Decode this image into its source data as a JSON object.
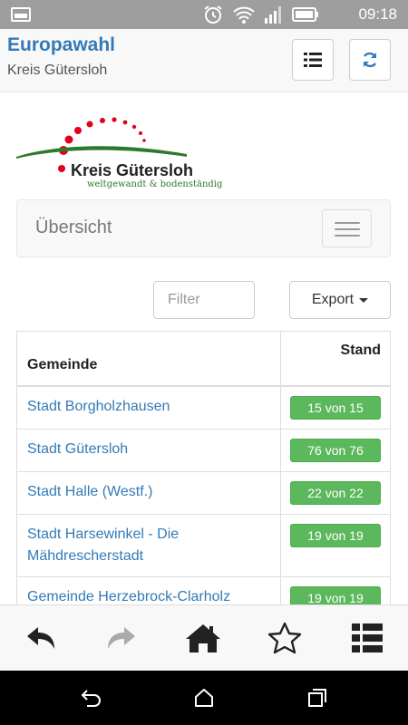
{
  "status_bar": {
    "time": "09:18",
    "icons": [
      "image-icon",
      "alarm-icon",
      "wifi-icon",
      "signal-icon",
      "battery-icon"
    ]
  },
  "header": {
    "title": "Europawahl",
    "subtitle": "Kreis Gütersloh",
    "buttons": [
      "list-icon",
      "refresh-icon"
    ]
  },
  "logo": {
    "name": "Kreis Gütersloh",
    "tagline": "weltgewandt & bodenständig"
  },
  "navbar": {
    "title": "Übersicht"
  },
  "toolbar": {
    "filter_placeholder": "Filter",
    "export_label": "Export"
  },
  "table": {
    "headers": {
      "gemeinde": "Gemeinde",
      "stand": "Stand"
    },
    "rows": [
      {
        "name": "Stadt Borgholzhausen",
        "stand": "15 von 15"
      },
      {
        "name": "Stadt Gütersloh",
        "stand": "76 von 76"
      },
      {
        "name": "Stadt Halle (Westf.)",
        "stand": "22 von 22"
      },
      {
        "name": "Stadt Harsewinkel - Die Mähdrescherstadt",
        "stand": "19 von 19"
      },
      {
        "name": "Gemeinde Herzebrock-Clarholz",
        "stand": "19 von 19"
      }
    ]
  },
  "bottom_bar": {
    "icons": [
      "back-arrow-icon",
      "forward-arrow-icon",
      "home-icon",
      "star-icon",
      "list-icon"
    ]
  },
  "android_nav": {
    "icons": [
      "back-icon",
      "home-icon",
      "recents-icon"
    ]
  },
  "colors": {
    "accent": "#337ab7",
    "success": "#5cb85c",
    "logo_red": "#e2001a",
    "logo_green": "#2c7a2c"
  }
}
